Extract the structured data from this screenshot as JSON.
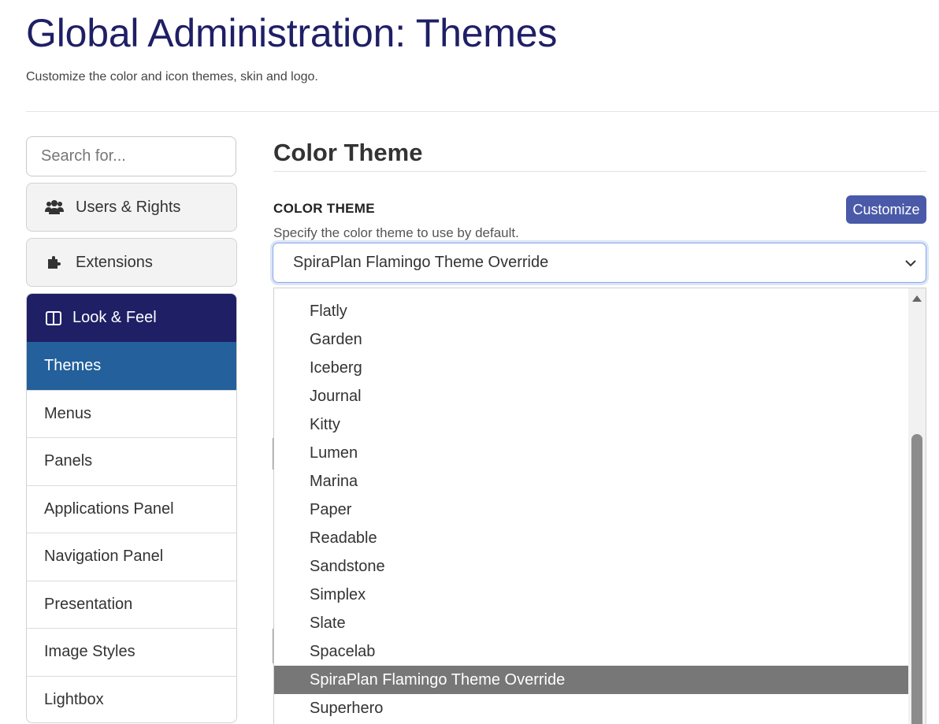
{
  "header": {
    "title": "Global Administration: Themes",
    "subtitle": "Customize the color and icon themes, skin and logo."
  },
  "sidebar": {
    "search_placeholder": "Search for...",
    "cards": [
      {
        "label": "Users & Rights",
        "icon": "users-icon"
      },
      {
        "label": "Extensions",
        "icon": "puzzle-icon"
      }
    ],
    "group": {
      "label": "Look & Feel",
      "icon": "columns-icon",
      "items": [
        "Themes",
        "Menus",
        "Panels",
        "Applications Panel",
        "Navigation Panel",
        "Presentation",
        "Image Styles",
        "Lightbox"
      ],
      "active_index": 0
    }
  },
  "main": {
    "section_title": "Color Theme",
    "field_label": "COLOR THEME",
    "customize_label": "Customize",
    "help_text": "Specify the color theme to use by default.",
    "selected_value": "SpiraPlan Flamingo Theme Override",
    "options": [
      "Flatly",
      "Garden",
      "Iceberg",
      "Journal",
      "Kitty",
      "Lumen",
      "Marina",
      "Paper",
      "Readable",
      "Sandstone",
      "Simplex",
      "Slate",
      "Spacelab",
      "SpiraPlan Flamingo Theme Override",
      "Superhero"
    ],
    "selected_option_index": 13
  },
  "colors": {
    "title": "#1f1f66",
    "group_header": "#1f1f66",
    "active_item": "#23609c",
    "button": "#4a5aa8",
    "highlight": "#777777"
  }
}
